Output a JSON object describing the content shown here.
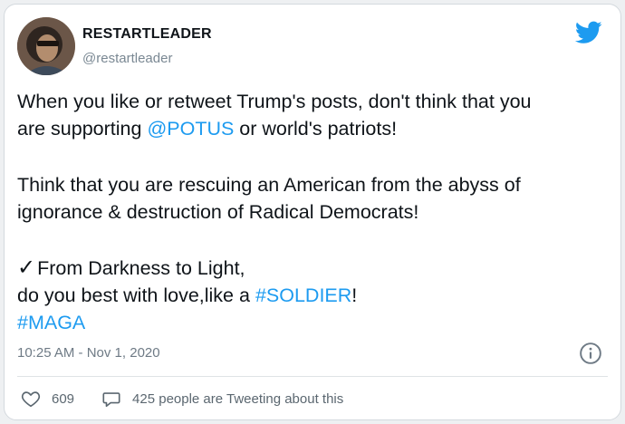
{
  "tweet": {
    "author": {
      "display_name": "RESTARTLEADER",
      "handle": "@restartleader",
      "avatar_icon": "profile-avatar"
    },
    "brand_icon": "twitter-bird-icon",
    "brand_color": "#1d9bf0",
    "body": {
      "p1_line1": "When you like or retweet Trump's posts, don't think that you",
      "p1_line2_pre": "are supporting ",
      "p1_mention": "@POTUS",
      "p1_line2_post": " or world's patriots!",
      "p2_line1": "Think that you are rescuing an American from the abyss of",
      "p2_line2": "ignorance & destruction of Radical Democrats!",
      "p3_check": "✓",
      "p3_line1": "From Darkness to Light,",
      "p3_line2_pre": "do you best with love,like a ",
      "p3_hashtag1": "#SOLDIER",
      "p3_line2_post": "!",
      "p3_hashtag2": "#MAGA"
    },
    "timestamp": "10:25 AM - Nov 1, 2020",
    "info_icon": "info-icon",
    "likes": "609",
    "tweeting_text": "425 people are Tweeting about this"
  }
}
